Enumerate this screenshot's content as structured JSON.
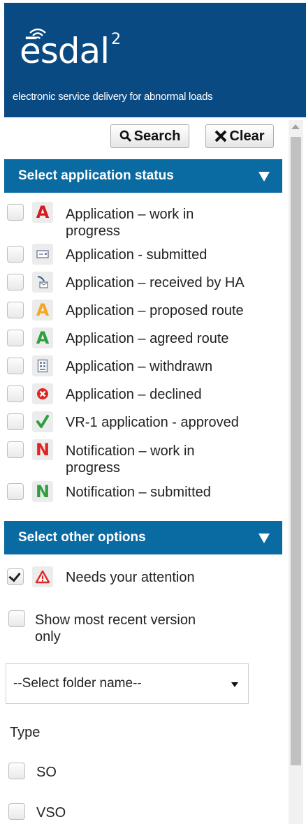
{
  "brand": {
    "logo": "ēsdal",
    "logo_sup": "2",
    "tagline": "electronic service delivery for abnormal loads"
  },
  "toolbar": {
    "search_label": "Search",
    "clear_label": "Clear"
  },
  "status_section": {
    "title": "Select application status",
    "items": [
      {
        "label": "Application – work in progress",
        "icon": "red-A-icon",
        "color": "#d71920",
        "checked": false
      },
      {
        "label": "Application - submitted",
        "icon": "document-icon",
        "color": "#6a7b93",
        "checked": false
      },
      {
        "label": "Application – received by HA",
        "icon": "envelope-received-icon",
        "color": "#6a7b93",
        "checked": false
      },
      {
        "label": "Application – proposed route",
        "icon": "orange-A-icon",
        "color": "#f5a623",
        "checked": false
      },
      {
        "label": "Application – agreed route",
        "icon": "green-A-icon",
        "color": "#2e9e3e",
        "checked": false
      },
      {
        "label": "Application – withdrawn",
        "icon": "withdrawn-doc-icon",
        "color": "#6a7b93",
        "checked": false
      },
      {
        "label": "Application – declined",
        "icon": "declined-x-icon",
        "color": "#e02424",
        "checked": false
      },
      {
        "label": "VR-1 application - approved",
        "icon": "green-check-icon",
        "color": "#2e9e3e",
        "checked": false
      },
      {
        "label": "Notification – work in progress",
        "icon": "red-N-icon",
        "color": "#e02424",
        "checked": false
      },
      {
        "label": "Notification – submitted",
        "icon": "green-N-icon",
        "color": "#2e9e3e",
        "checked": false
      }
    ]
  },
  "other_section": {
    "title": "Select other options",
    "attention_label": "Needs your attention",
    "attention_checked": true,
    "recent_label": "Show most recent version only",
    "recent_checked": false,
    "folder_select": "--Select folder name--",
    "type_label": "Type",
    "types": [
      {
        "label": "SO",
        "checked": false
      },
      {
        "label": "VSO",
        "checked": false
      }
    ]
  }
}
